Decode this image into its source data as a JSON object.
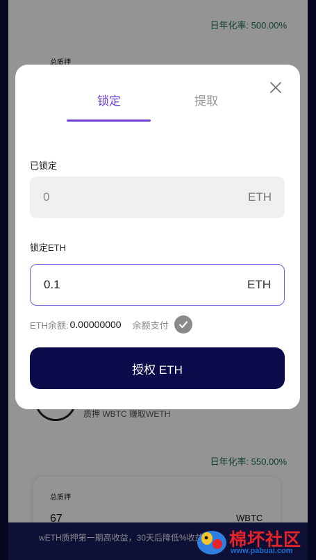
{
  "background_page": {
    "apy_top": "日年化率: 500.00%",
    "total_stake_label_top": "总质押",
    "pool_description": "质押 WBTC 赚取WETH",
    "apy_mid": "日年化率: 550.00%",
    "total_stake_label_bottom": "总质押",
    "total_stake_value": "67",
    "total_stake_unit": "WBTC",
    "footer_notice": "wETH质押第一期高收益，30天后降低%收益"
  },
  "watermark": {
    "text": "棉坏社区",
    "url": "www.pabuai.com"
  },
  "modal": {
    "tabs": [
      {
        "label": "锁定",
        "active": true
      },
      {
        "label": "提取",
        "active": false
      }
    ],
    "locked_label": "已锁定",
    "locked_value": "0",
    "locked_unit": "ETH",
    "lock_label": "锁定ETH",
    "lock_input_value": "0.1",
    "lock_input_unit": "ETH",
    "balance_label": "ETH余额:",
    "balance_value": "0.00000000",
    "balance_pay_label": "余额支付",
    "authorize_button": "授权 ETH"
  },
  "colors": {
    "accent": "#6c3fd2",
    "button": "#0b0a4a",
    "apy_green": "#1b6b4d"
  }
}
